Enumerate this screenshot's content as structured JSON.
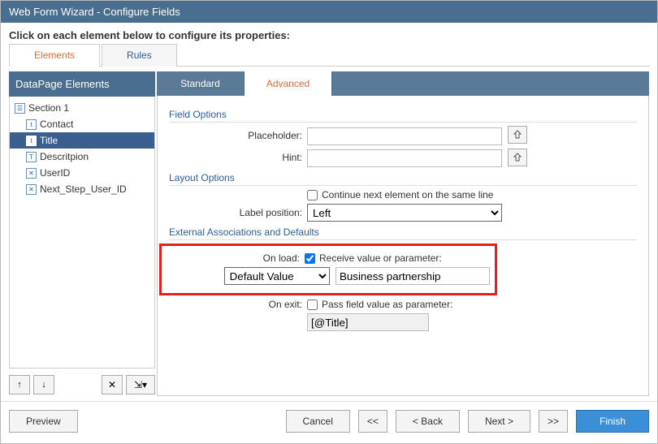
{
  "title": "Web Form Wizard - Configure Fields",
  "instruction": "Click on each element below to configure its properties:",
  "tabs": {
    "elements": "Elements",
    "rules": "Rules"
  },
  "left": {
    "header": "DataPage Elements",
    "nodes": [
      {
        "label": "Section 1",
        "icon": "☰",
        "indent": false,
        "selected": false
      },
      {
        "label": "Contact",
        "icon": "t",
        "indent": true,
        "selected": false
      },
      {
        "label": "Title",
        "icon": "t",
        "indent": true,
        "selected": true
      },
      {
        "label": "Descritpion",
        "icon": "T",
        "indent": true,
        "selected": false
      },
      {
        "label": "UserID",
        "icon": "✕",
        "indent": true,
        "selected": false
      },
      {
        "label": "Next_Step_User_ID",
        "icon": "✕",
        "indent": true,
        "selected": false
      }
    ],
    "toolbar": {
      "up": "↑",
      "down": "↓",
      "delete": "✕",
      "insert": "⇲▾"
    }
  },
  "inner_tabs": {
    "standard": "Standard",
    "advanced": "Advanced"
  },
  "sections": {
    "field_options": "Field Options",
    "layout_options": "Layout Options",
    "external": "External Associations and Defaults"
  },
  "labels": {
    "placeholder": "Placeholder:",
    "hint": "Hint:",
    "continue_same_line": "Continue next element on the same line",
    "label_position": "Label position:",
    "on_load": "On load:",
    "receive_value": "Receive value or parameter:",
    "on_exit": "On exit:",
    "pass_value": "Pass field value as parameter:"
  },
  "values": {
    "placeholder_value": "",
    "hint_value": "",
    "continue_same_line_checked": false,
    "label_position_selected": "Left",
    "receive_checked": true,
    "onload_source_selected": "Default Value",
    "onload_value": "Business partnership",
    "pass_value_checked": false,
    "exit_param": "[@Title]"
  },
  "footer": {
    "preview": "Preview",
    "cancel": "Cancel",
    "first": "<<",
    "back": "< Back",
    "next": "Next >",
    "last": ">>",
    "finish": "Finish"
  }
}
